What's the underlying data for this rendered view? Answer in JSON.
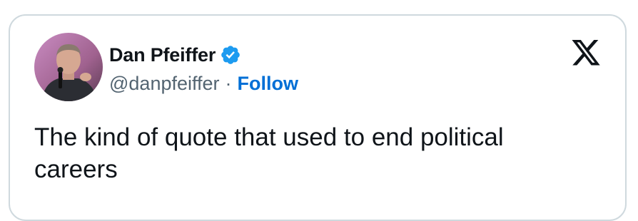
{
  "author": {
    "display_name": "Dan Pfeiffer",
    "handle": "@danpfeiffer",
    "separator": "·",
    "follow_label": "Follow",
    "verified": true,
    "avatar_icon": "profile-photo"
  },
  "tweet": {
    "text": "The kind of quote that used to end political careers"
  },
  "brand": {
    "logo_icon": "x-logo-icon"
  },
  "colors": {
    "accent": "#1d9bf0",
    "follow": "#006fd6",
    "text": "#0f1419",
    "secondary_text": "#536471",
    "border": "#cfd9de"
  }
}
